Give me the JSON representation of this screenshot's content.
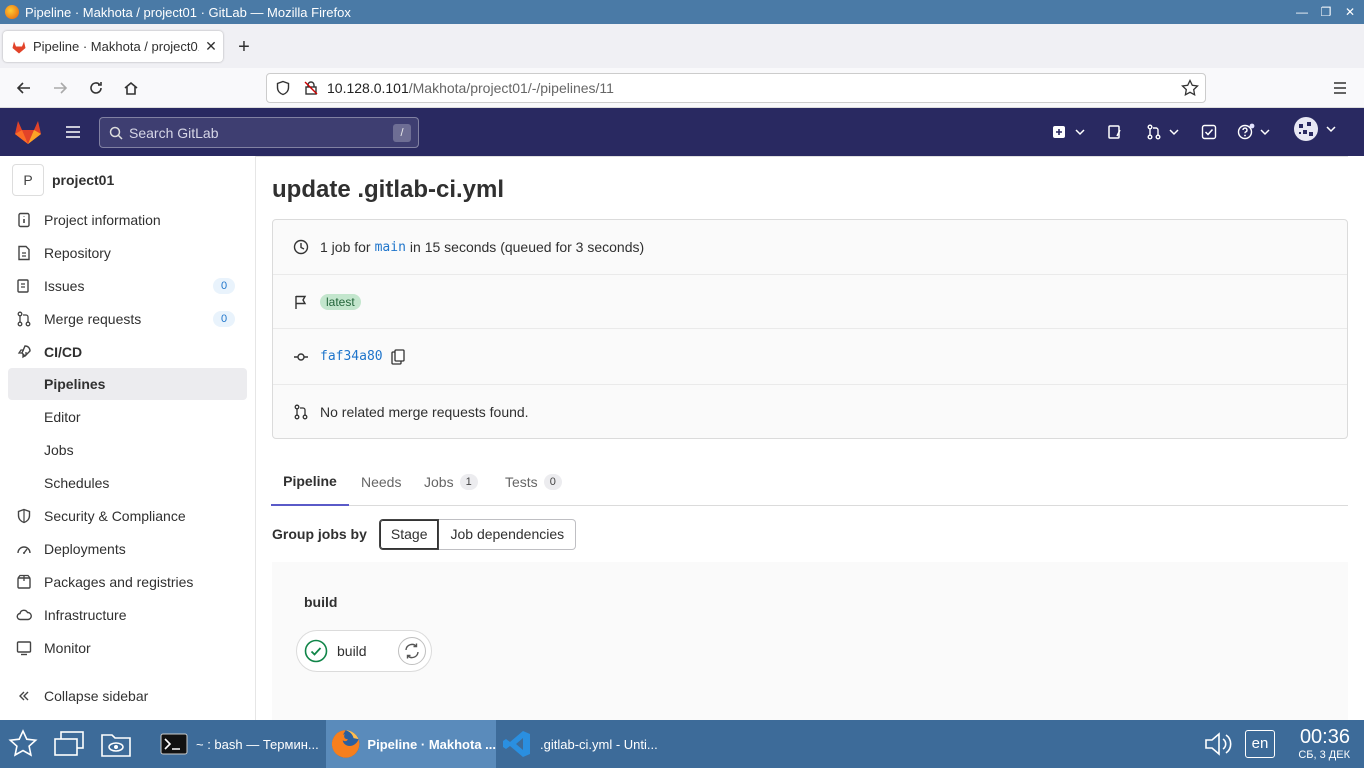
{
  "window": {
    "title": "Pipeline · Makhota / project01 · GitLab — Mozilla Firefox"
  },
  "browser": {
    "tab_title": "Pipeline · Makhota / project01 · GitLab",
    "url_host": "10.128.0.101",
    "url_path": "/Makhota/project01/-/pipelines/11"
  },
  "header": {
    "search_placeholder": "Search GitLab",
    "search_shortcut": "/"
  },
  "sidebar": {
    "project_initial": "P",
    "project_name": "project01",
    "items": [
      {
        "label": "Project information",
        "icon": "info-icon"
      },
      {
        "label": "Repository",
        "icon": "doc-icon"
      },
      {
        "label": "Issues",
        "icon": "issues-icon",
        "badge": "0"
      },
      {
        "label": "Merge requests",
        "icon": "merge-icon",
        "badge": "0"
      },
      {
        "label": "CI/CD",
        "icon": "rocket-icon"
      },
      {
        "label": "Pipelines"
      },
      {
        "label": "Editor"
      },
      {
        "label": "Jobs"
      },
      {
        "label": "Schedules"
      },
      {
        "label": "Security & Compliance",
        "icon": "shield-icon"
      },
      {
        "label": "Deployments",
        "icon": "deploy-icon"
      },
      {
        "label": "Packages and registries",
        "icon": "package-icon"
      },
      {
        "label": "Infrastructure",
        "icon": "cloud-icon"
      },
      {
        "label": "Monitor",
        "icon": "monitor-icon"
      }
    ],
    "collapse_label": "Collapse sidebar"
  },
  "pipeline": {
    "title": "update .gitlab-ci.yml",
    "summary_prefix": "1 job for",
    "branch": "main",
    "summary_suffix": "in 15 seconds (queued for 3 seconds)",
    "badge": "latest",
    "commit_sha": "faf34a80",
    "merge_requests": "No related merge requests found."
  },
  "tabs": [
    {
      "label": "Pipeline"
    },
    {
      "label": "Needs"
    },
    {
      "label": "Jobs",
      "count": "1"
    },
    {
      "label": "Tests",
      "count": "0"
    }
  ],
  "group_by": {
    "label": "Group jobs by",
    "options": [
      "Stage",
      "Job dependencies"
    ],
    "selected": "Stage"
  },
  "graph": {
    "stage": "build",
    "job_name": "build",
    "job_status": "success"
  },
  "taskbar": {
    "items": [
      "~ : bash — Термин...",
      "Pipeline · Makhota ...",
      ".gitlab-ci.yml - Unti..."
    ],
    "lang": "en",
    "time": "00:36",
    "date": "СБ, 3 ДЕК"
  },
  "colors": {
    "header_bg": "#292961",
    "taskbar_bg": "#3d6b99",
    "success": "#108548",
    "link": "#1f75cb"
  }
}
